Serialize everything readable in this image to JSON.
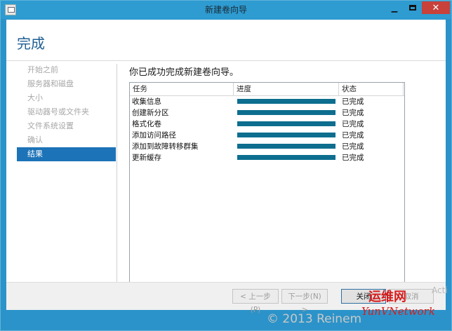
{
  "window": {
    "title": "新建卷向导",
    "controls": {
      "minimize": "▁",
      "close": "✕"
    }
  },
  "page": {
    "title": "完成"
  },
  "nav": {
    "items": [
      {
        "label": "开始之前",
        "active": false
      },
      {
        "label": "服务器和磁盘",
        "active": false
      },
      {
        "label": "大小",
        "active": false
      },
      {
        "label": "驱动器号或文件夹",
        "active": false
      },
      {
        "label": "文件系统设置",
        "active": false
      },
      {
        "label": "确认",
        "active": false
      },
      {
        "label": "结果",
        "active": true
      }
    ]
  },
  "content": {
    "heading": "你已成功完成新建卷向导。",
    "table": {
      "headers": {
        "task": "任务",
        "progress": "进度",
        "status": "状态"
      },
      "rows": [
        {
          "task": "收集信息",
          "progress": 1.0,
          "status": "已完成"
        },
        {
          "task": "创建新分区",
          "progress": 1.0,
          "status": "已完成"
        },
        {
          "task": "格式化卷",
          "progress": 1.0,
          "status": "已完成"
        },
        {
          "task": "添加访问路径",
          "progress": 1.0,
          "status": "已完成"
        },
        {
          "task": "添加到故障转移群集",
          "progress": 1.0,
          "status": "已完成"
        },
        {
          "task": "更新缓存",
          "progress": 1.0,
          "status": "已完成"
        }
      ]
    }
  },
  "footer": {
    "prev_label": "< 上一步(P)",
    "next_label": "下一步(N) >",
    "close_label": "关闭",
    "cancel_label": "取消"
  },
  "overlay": {
    "copyright": "© 2013 Reinem",
    "logo_text_cn": "运维网",
    "logo_text_en": "YunVNetwork",
    "activation": "Acti"
  },
  "colors": {
    "title_bar": "#2e9bd1",
    "close_button": "#c8413a",
    "accent": "#1d73b7",
    "progress": "#0d6e8f"
  }
}
